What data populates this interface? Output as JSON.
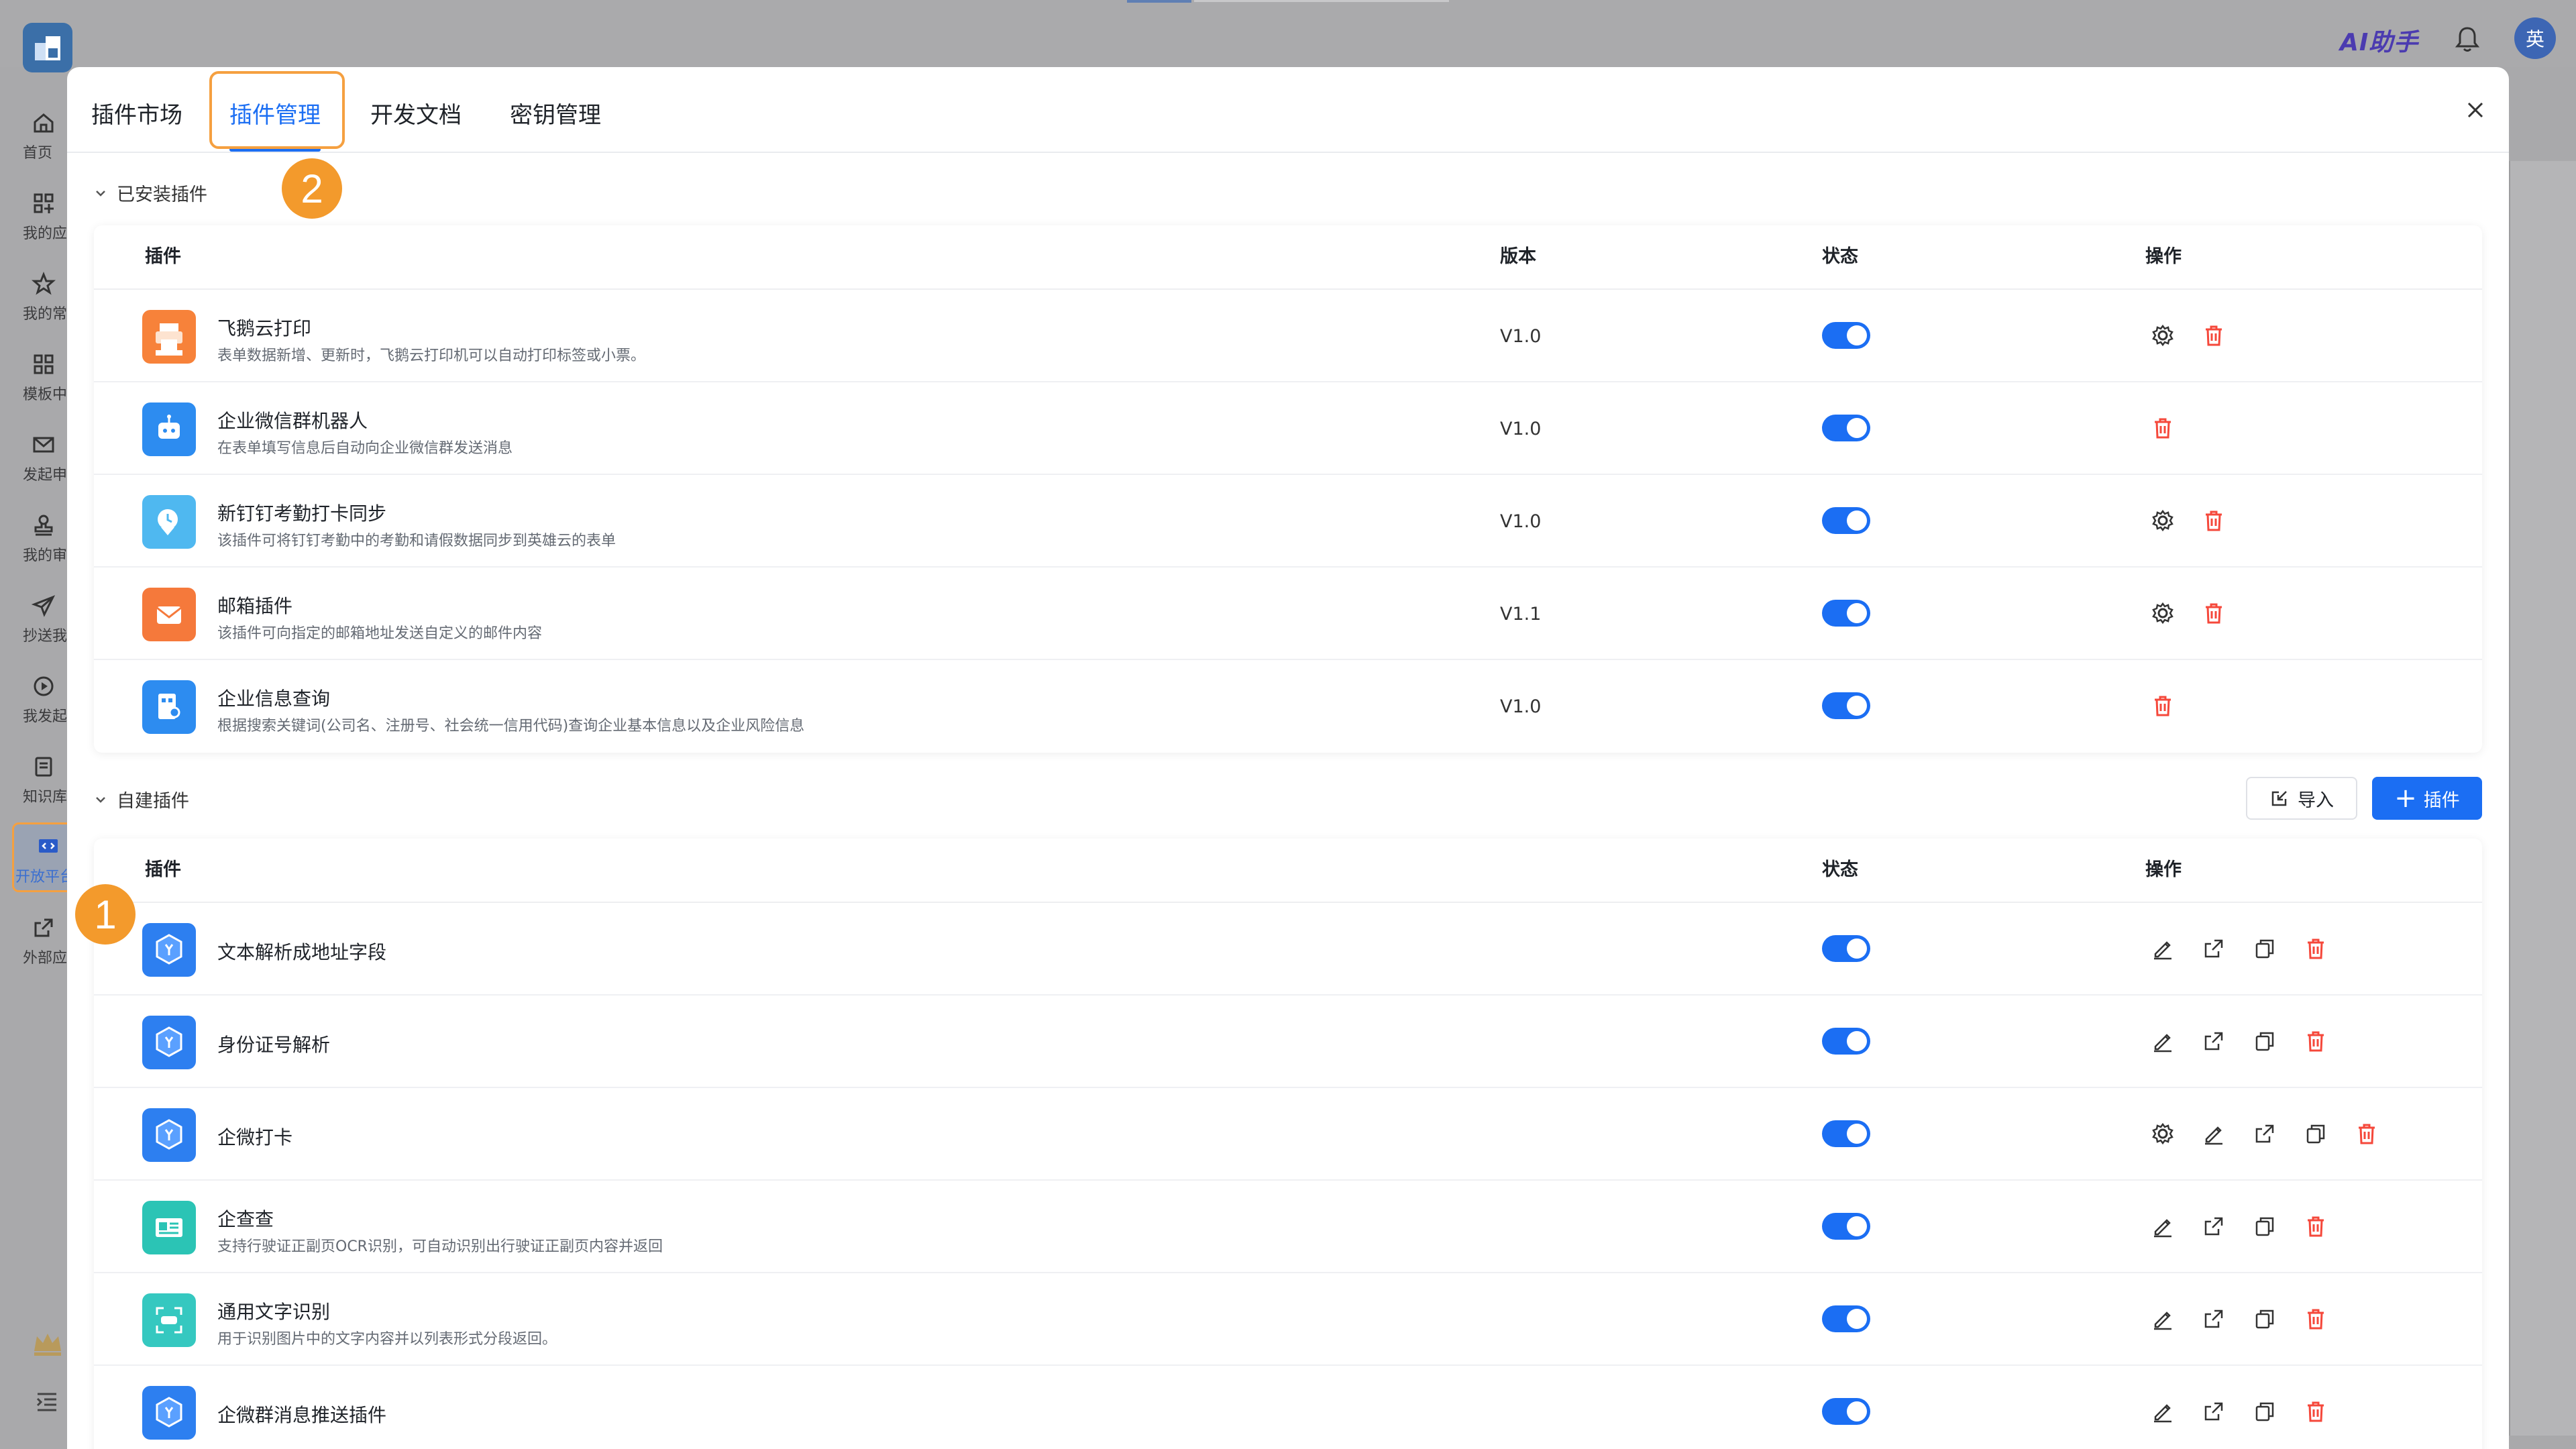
{
  "app": {
    "ai_helper": "AI助手",
    "avatar_text": "英"
  },
  "sidebar": {
    "items": [
      {
        "label": "首页",
        "icon": "home-icon"
      },
      {
        "label": "我的应用",
        "icon": "apps-icon"
      },
      {
        "label": "我的常用",
        "icon": "star-icon"
      },
      {
        "label": "模板中心",
        "icon": "template-icon"
      },
      {
        "label": "发起申请",
        "icon": "mail-icon"
      },
      {
        "label": "我的审批",
        "icon": "stamp-icon"
      },
      {
        "label": "抄送我的",
        "icon": "send-icon"
      },
      {
        "label": "我发起的",
        "icon": "play-icon"
      },
      {
        "label": "知识库",
        "icon": "book-icon"
      },
      {
        "label": "开放平台",
        "icon": "code-icon"
      },
      {
        "label": "外部应用",
        "icon": "external-icon"
      }
    ]
  },
  "modal": {
    "tabs": [
      {
        "label": "插件市场"
      },
      {
        "label": "插件管理"
      },
      {
        "label": "开发文档"
      },
      {
        "label": "密钥管理"
      }
    ],
    "active_tab": "插件管理"
  },
  "badges": {
    "one": "1",
    "two": "2"
  },
  "installed": {
    "title": "已安装插件",
    "headers": {
      "plugin": "插件",
      "version": "版本",
      "status": "状态",
      "action": "操作"
    },
    "rows": [
      {
        "name": "飞鹅云打印",
        "desc": "表单数据新增、更新时，飞鹅云打印机可以自动打印标签或小票。",
        "version": "V1.0",
        "enabled": true,
        "icon_color": "#f7823a",
        "actions": [
          "settings",
          "delete"
        ]
      },
      {
        "name": "企业微信群机器人",
        "desc": "在表单填写信息后自动向企业微信群发送消息",
        "version": "V1.0",
        "enabled": true,
        "icon_color": "#2d8cf0",
        "actions": [
          "delete"
        ]
      },
      {
        "name": "新钉钉考勤打卡同步",
        "desc": "该插件可将钉钉考勤中的考勤和请假数据同步到英雄云的表单",
        "version": "V1.0",
        "enabled": true,
        "icon_color": "#4fb8f0",
        "actions": [
          "settings",
          "delete"
        ]
      },
      {
        "name": "邮箱插件",
        "desc": "该插件可向指定的邮箱地址发送自定义的邮件内容",
        "version": "V1.1",
        "enabled": true,
        "icon_color": "#f5793b",
        "actions": [
          "settings",
          "delete"
        ]
      },
      {
        "name": "企业信息查询",
        "desc": "根据搜索关键词(公司名、注册号、社会统一信用代码)查询企业基本信息以及企业风险信息",
        "version": "V1.0",
        "enabled": true,
        "icon_color": "#2d8cf0",
        "actions": [
          "delete"
        ]
      }
    ]
  },
  "custom": {
    "title": "自建插件",
    "import_label": "导入",
    "add_label": "插件",
    "headers": {
      "plugin": "插件",
      "status": "状态",
      "action": "操作"
    },
    "rows": [
      {
        "name": "文本解析成地址字段",
        "desc": "",
        "enabled": true,
        "icon_color": "#2d7ff0",
        "actions": [
          "edit",
          "export",
          "copy",
          "delete"
        ]
      },
      {
        "name": "身份证号解析",
        "desc": "",
        "enabled": true,
        "icon_color": "#2d7ff0",
        "actions": [
          "edit",
          "export",
          "copy",
          "delete"
        ]
      },
      {
        "name": "企微打卡",
        "desc": "",
        "enabled": true,
        "icon_color": "#2d7ff0",
        "actions": [
          "settings",
          "edit",
          "export",
          "copy",
          "delete"
        ]
      },
      {
        "name": "企查查",
        "desc": "支持行驶证正副页OCR识别，可自动识别出行驶证正副页内容并返回",
        "enabled": true,
        "icon_color": "#2bc4b5",
        "actions": [
          "edit",
          "export",
          "copy",
          "delete"
        ]
      },
      {
        "name": "通用文字识别",
        "desc": "用于识别图片中的文字内容并以列表形式分段返回。",
        "enabled": true,
        "icon_color": "#35c8c0",
        "actions": [
          "edit",
          "export",
          "copy",
          "delete"
        ]
      },
      {
        "name": "企微群消息推送插件",
        "desc": "",
        "enabled": true,
        "icon_color": "#2d7ff0",
        "actions": [
          "edit",
          "export",
          "copy",
          "delete"
        ]
      }
    ]
  },
  "colors": {
    "primary": "#1b6ef3",
    "danger": "#f5483b",
    "highlight": "#f5a040"
  }
}
